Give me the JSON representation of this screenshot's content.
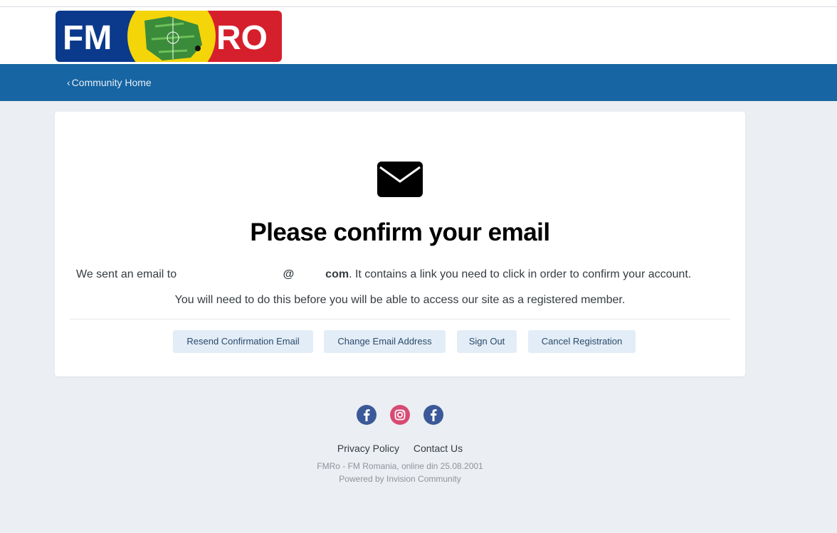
{
  "logo": {
    "left_text": "FM",
    "right_text": "RO"
  },
  "nav": {
    "back_link": "Community Home"
  },
  "card": {
    "title": "Please confirm your email",
    "line1_prefix": "We sent an email to",
    "line1_at": "@",
    "line1_domain": "com",
    "line1_suffix": ". It contains a link you need to click in order to confirm your account.",
    "line2": "You will need to do this before you will be able to access our site as a registered member."
  },
  "buttons": {
    "resend": "Resend Confirmation Email",
    "change": "Change Email Address",
    "signout": "Sign Out",
    "cancel": "Cancel Registration"
  },
  "social": [
    "facebook-icon",
    "instagram-icon",
    "facebook-icon"
  ],
  "footer": {
    "privacy": "Privacy Policy",
    "contact": "Contact Us",
    "copyright": "FMRo - FM Romania, online din 25.08.2001",
    "powered": "Powered by Invision Community"
  },
  "colors": {
    "nav": "#1765a2",
    "logo_blue": "#0b3a8c",
    "logo_red": "#d61f2c",
    "logo_yellow": "#f4d50a",
    "button_bg": "#e3edf7"
  }
}
